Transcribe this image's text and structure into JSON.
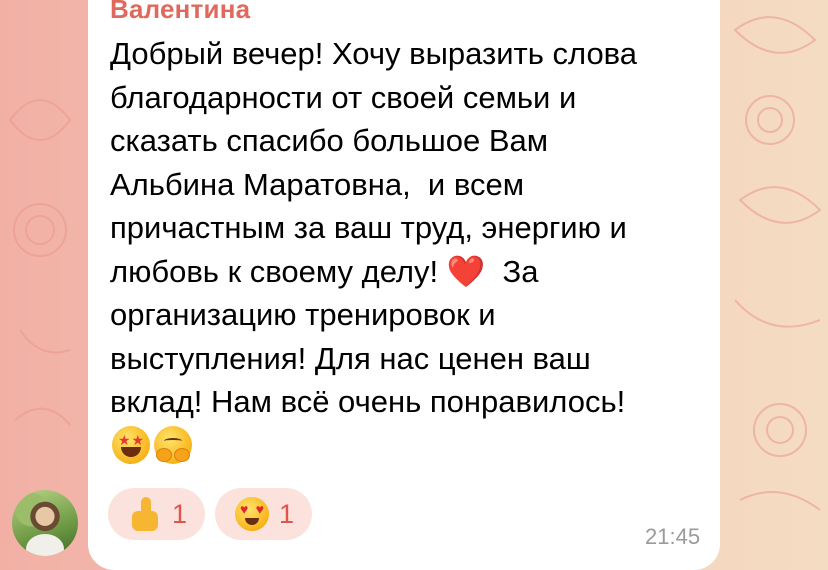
{
  "message": {
    "sender": "Валентина",
    "text": "Добрый вечер! Хочу выразить слова\nблагодарности от своей семьи и\nсказать спасибо большое Вам\nАльбина Маратовна,  и всем\nпричастным за ваш труд, энергию и\nлюбовь к своему делу! ❤️  За\nорганизацию тренировок и\nвыступления! Для нас ценен ваш\nвклад! Нам всё очень понравилось!",
    "emojis": [
      "star-struck-emoji",
      "hugging-face-emoji"
    ],
    "time": "21:45"
  },
  "reactions": [
    {
      "emoji": "thumbs-up-emoji",
      "count": "1"
    },
    {
      "emoji": "heart-eyes-emoji",
      "count": "1"
    }
  ],
  "colors": {
    "sender": "#e0695e",
    "reaction_bg": "#fbe2dc",
    "reaction_count": "#e0554b",
    "bubble": "#ffffff"
  }
}
